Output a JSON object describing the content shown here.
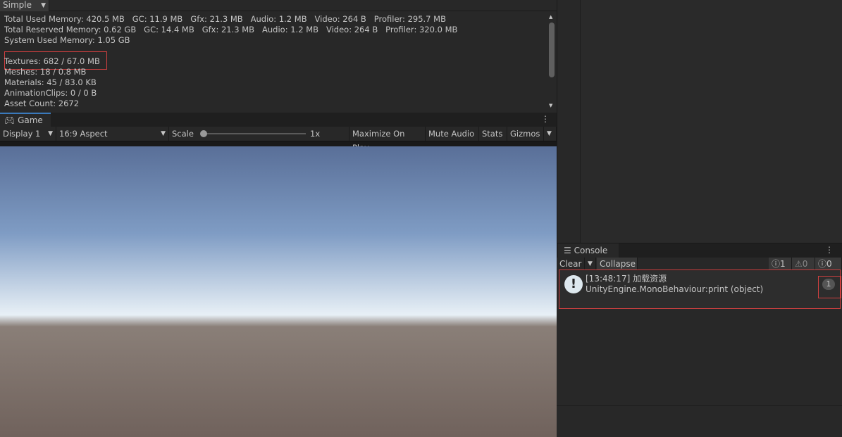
{
  "memory": {
    "mode": "Simple",
    "lines": [
      "Total Used Memory: 420.5 MB   GC: 11.9 MB   Gfx: 21.3 MB   Audio: 1.2 MB   Video: 264 B   Profiler: 295.7 MB",
      "Total Reserved Memory: 0.62 GB   GC: 14.4 MB   Gfx: 21.3 MB   Audio: 1.2 MB   Video: 264 B   Profiler: 320.0 MB",
      "System Used Memory: 1.05 GB",
      "",
      "Textures: 682 / 67.0 MB",
      "Meshes: 18 / 0.8 MB",
      "Materials: 45 / 83.0 KB",
      "AnimationClips: 0 / 0 B",
      "Asset Count: 2672"
    ]
  },
  "game": {
    "tab": "Game",
    "display": "Display 1",
    "aspect": "16:9 Aspect",
    "scale_label": "Scale",
    "scale_value": "1x",
    "maximize": "Maximize On Play",
    "mute": "Mute Audio",
    "stats": "Stats",
    "gizmos": "Gizmos"
  },
  "console": {
    "tab": "Console",
    "clear": "Clear",
    "collapse": "Collapse",
    "info_count": "1",
    "warn_count": "0",
    "error_count": "0",
    "entries": [
      {
        "line1": "[13:48:17] 加载资源",
        "line2": "UnityEngine.MonoBehaviour:print (object)",
        "count": "1"
      }
    ]
  },
  "colors": {
    "accent": "#3a79bb",
    "highlight": "#d04040"
  }
}
